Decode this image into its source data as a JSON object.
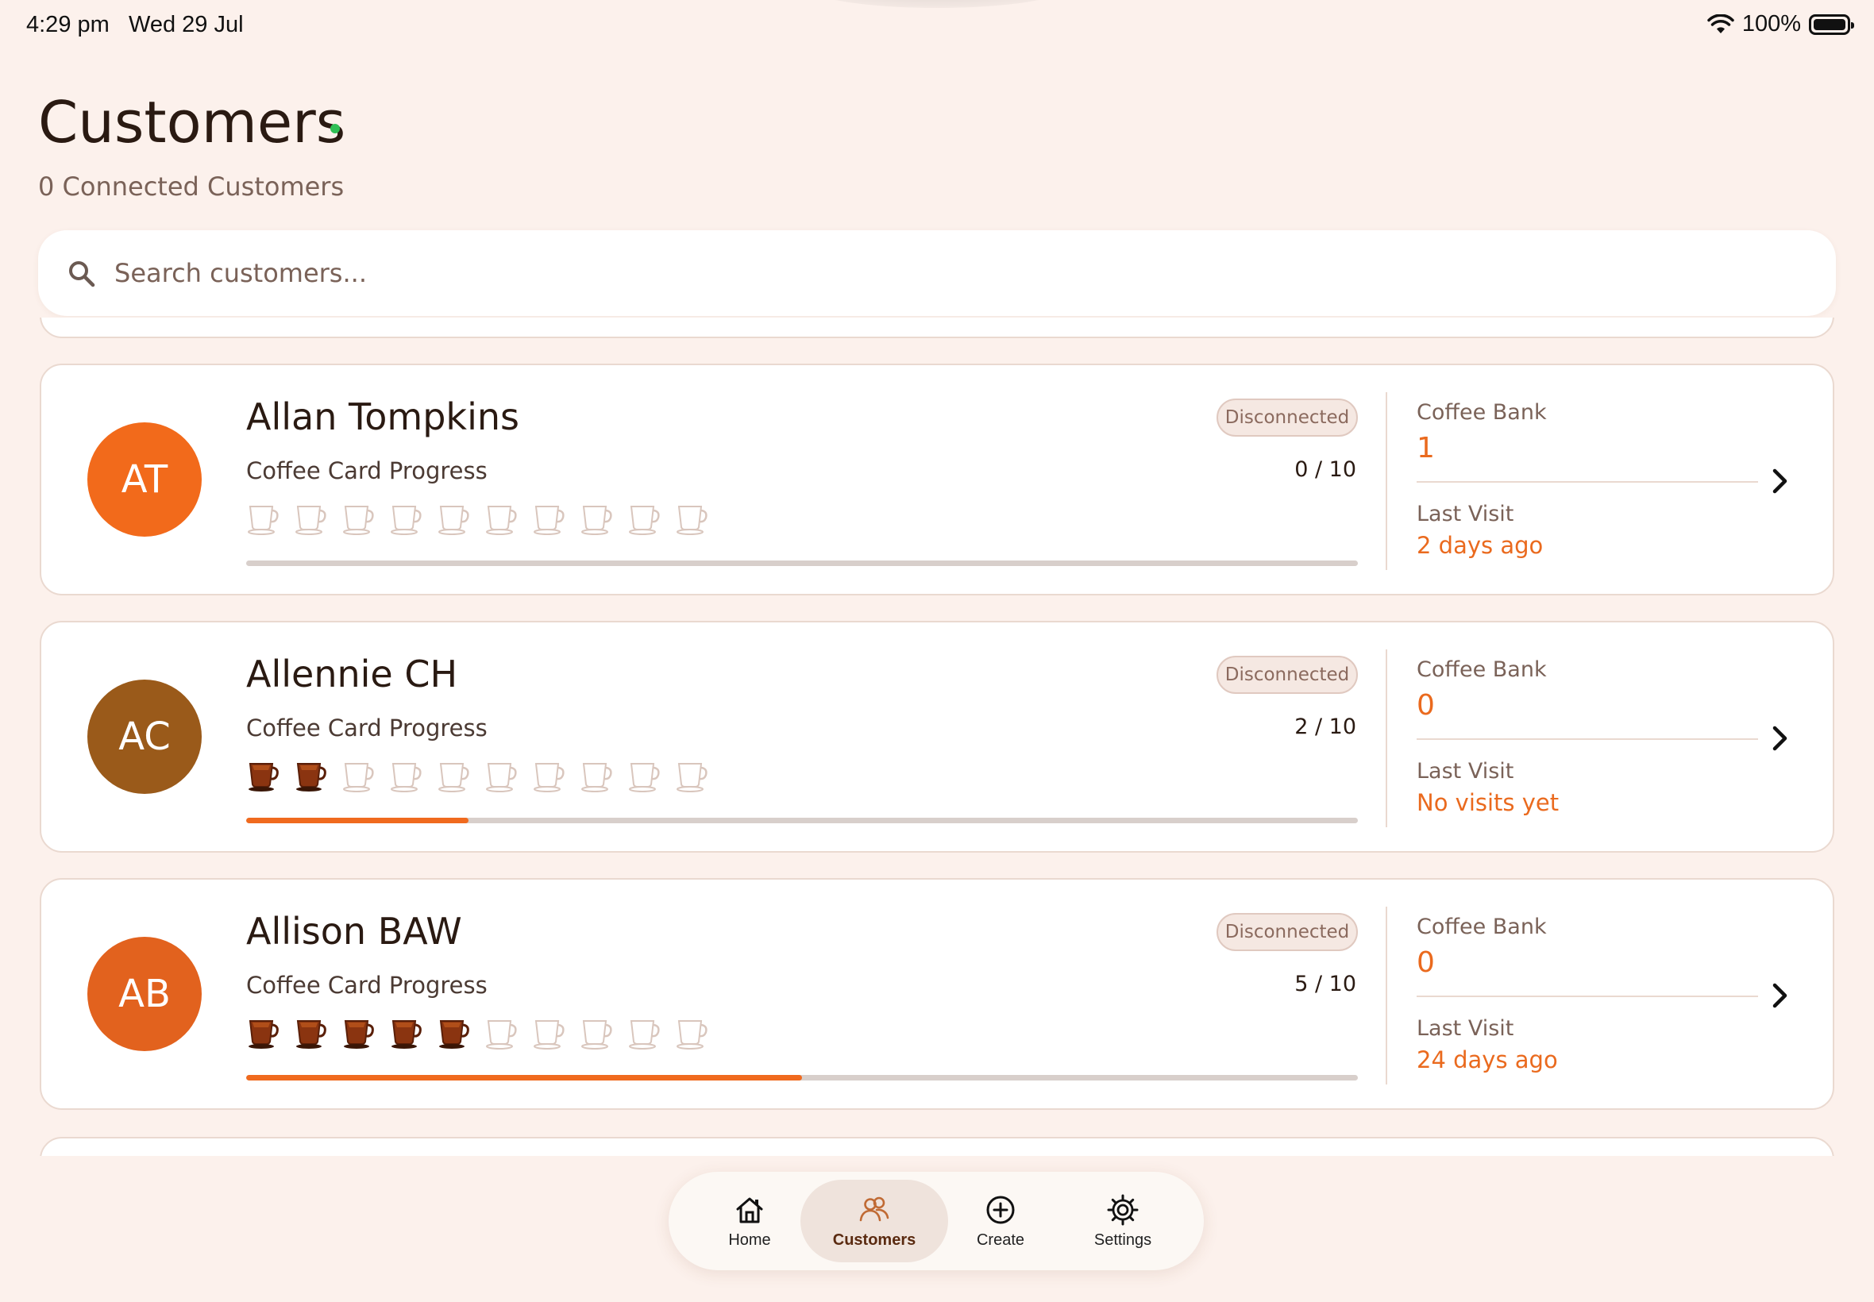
{
  "status_bar": {
    "time": "4:29 pm",
    "date": "Wed 29 Jul",
    "battery": "100%"
  },
  "header": {
    "title": "Customers",
    "connected_count": "0 Connected Customers"
  },
  "search": {
    "placeholder": "Search customers..."
  },
  "labels": {
    "progress": "Coffee Card Progress",
    "coffee_bank": "Coffee Bank",
    "last_visit": "Last Visit"
  },
  "customers": [
    {
      "initials": "AT",
      "name": "Allan Tompkins",
      "status": "Disconnected",
      "progress_text": "0 / 10",
      "stamps": 0,
      "total": 10,
      "coffee_bank": "1",
      "last_visit": "2 days ago",
      "avatar_color": "#f26a1b"
    },
    {
      "initials": "AC",
      "name": "Allennie CH",
      "status": "Disconnected",
      "progress_text": "2 / 10",
      "stamps": 2,
      "total": 10,
      "coffee_bank": "0",
      "last_visit": "No visits yet",
      "avatar_color": "#9a5a1a"
    },
    {
      "initials": "AB",
      "name": "Allison BAW",
      "status": "Disconnected",
      "progress_text": "5 / 10",
      "stamps": 5,
      "total": 10,
      "coffee_bank": "0",
      "last_visit": "24 days ago",
      "avatar_color": "#e2621e"
    }
  ],
  "nav": {
    "items": [
      {
        "label": "Home",
        "icon": "home-icon"
      },
      {
        "label": "Customers",
        "icon": "customers-icon",
        "active": true
      },
      {
        "label": "Create",
        "icon": "plus-circle-icon"
      },
      {
        "label": "Settings",
        "icon": "gear-icon"
      }
    ]
  },
  "colors": {
    "background": "#fcf1ec",
    "accent": "#f06a1e",
    "online_dot": "#2fbf55"
  }
}
